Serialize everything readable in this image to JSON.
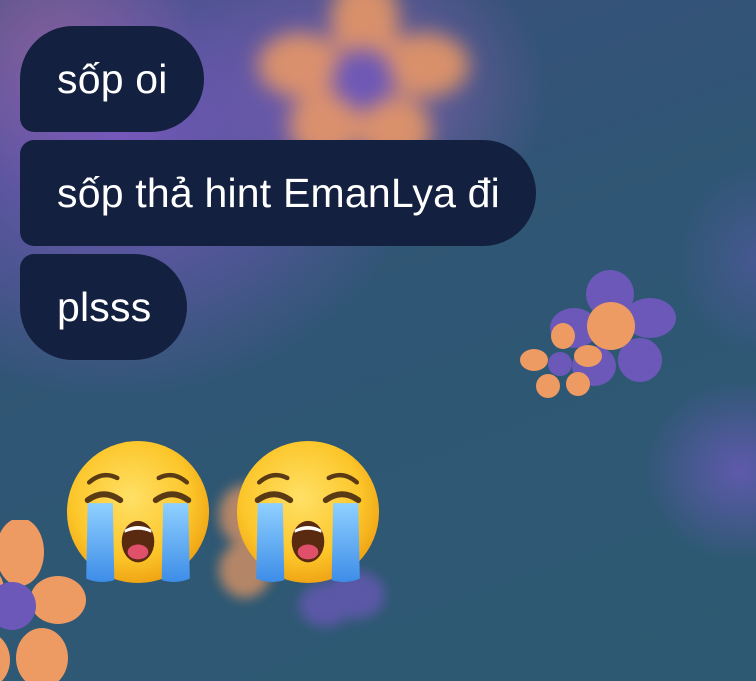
{
  "chat": {
    "messages": [
      {
        "text": "sốp oi"
      },
      {
        "text": "sốp thả hint EmanLya đi"
      },
      {
        "text": "plsss"
      }
    ],
    "emoji_message": {
      "emojis": [
        "loudly-crying-face-icon",
        "loudly-crying-face-icon"
      ]
    }
  },
  "colors": {
    "bubble_background": "#14203f",
    "bubble_text": "#ffffff",
    "wallpaper_base": "#2f5573",
    "flower_orange": "#ee9a63",
    "flower_purple": "#6b58b8"
  }
}
